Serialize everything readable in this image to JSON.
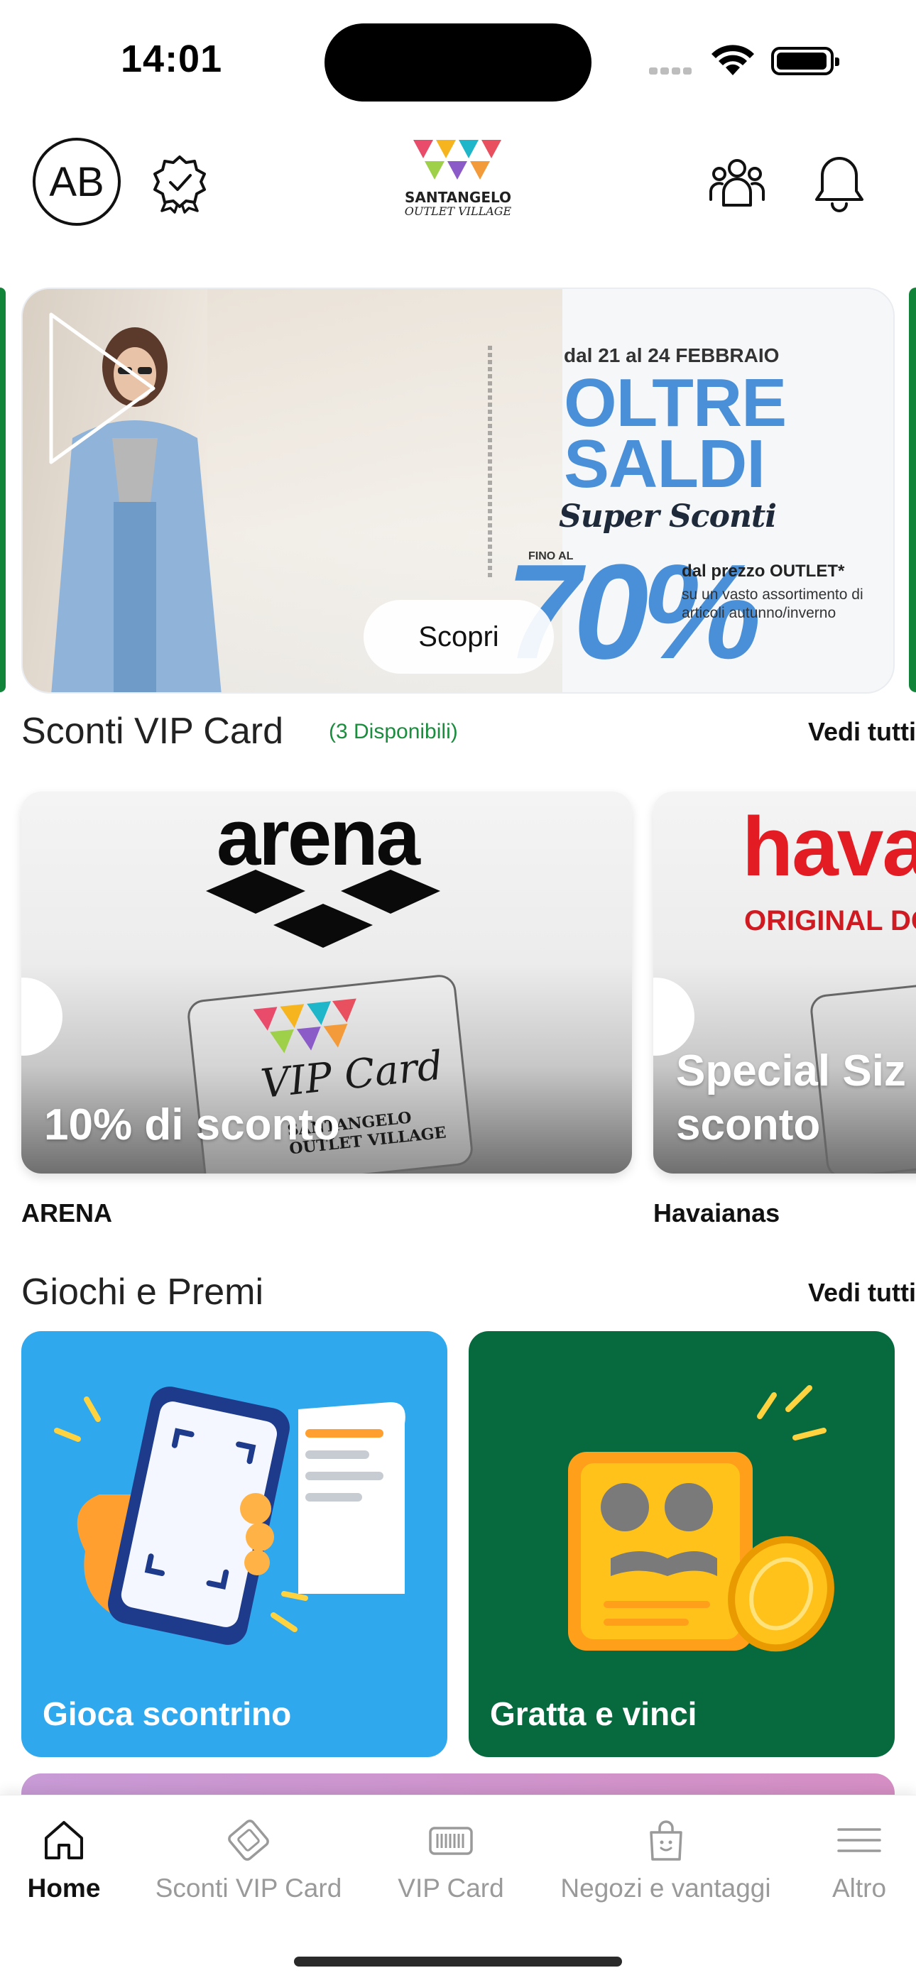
{
  "status_bar": {
    "time": "14:01"
  },
  "header": {
    "avatar_initials": "AB",
    "logo_line1": "SANTANGELO",
    "logo_line2": "OUTLET VILLAGE"
  },
  "hero": {
    "dates": "dal 21 al 24 FEBBRAIO",
    "title": "OLTRE SALDI",
    "subtitle": "Super Sconti",
    "upto": "FINO AL",
    "percent": "70%",
    "offer_line": "dal prezzo OUTLET*",
    "offer_detail": "su un vasto assortimento di articoli autunno/inverno",
    "cta": "Scopri"
  },
  "vip_section": {
    "title": "Sconti VIP Card",
    "count": "(3 Disponibili)",
    "see_all": "Vedi tutti",
    "coupons": [
      {
        "brand_logo": "arena",
        "caption": "10% di sconto",
        "brand": "ARENA",
        "card_label": "VIP Card",
        "card_sub": "SANTANGELO OUTLET VILLAGE"
      },
      {
        "brand_logo": "hava",
        "brand_sub": "ORIGINAL DO",
        "caption": "Special Siz di sconto",
        "brand": "Havaianas"
      }
    ]
  },
  "games_section": {
    "title": "Giochi e Premi",
    "see_all": "Vedi tutti",
    "games": [
      {
        "label": "Gioca scontrino",
        "color": "#2fa8ee"
      },
      {
        "label": "Gratta e vinci",
        "color": "#076a3f"
      }
    ]
  },
  "tabbar": {
    "items": [
      {
        "label": "Home",
        "icon": "home-icon",
        "active": true
      },
      {
        "label": "Sconti VIP Card",
        "icon": "ticket-icon",
        "active": false
      },
      {
        "label": "VIP Card",
        "icon": "barcode-card-icon",
        "active": false
      },
      {
        "label": "Negozi e vantaggi",
        "icon": "shopping-bag-icon",
        "active": false
      },
      {
        "label": "Altro",
        "icon": "menu-icon",
        "active": false
      }
    ]
  },
  "colors": {
    "accent_green": "#1b8d3e",
    "hero_blue": "#4a90d9",
    "game_blue": "#2fa8ee",
    "game_green": "#076a3f"
  }
}
